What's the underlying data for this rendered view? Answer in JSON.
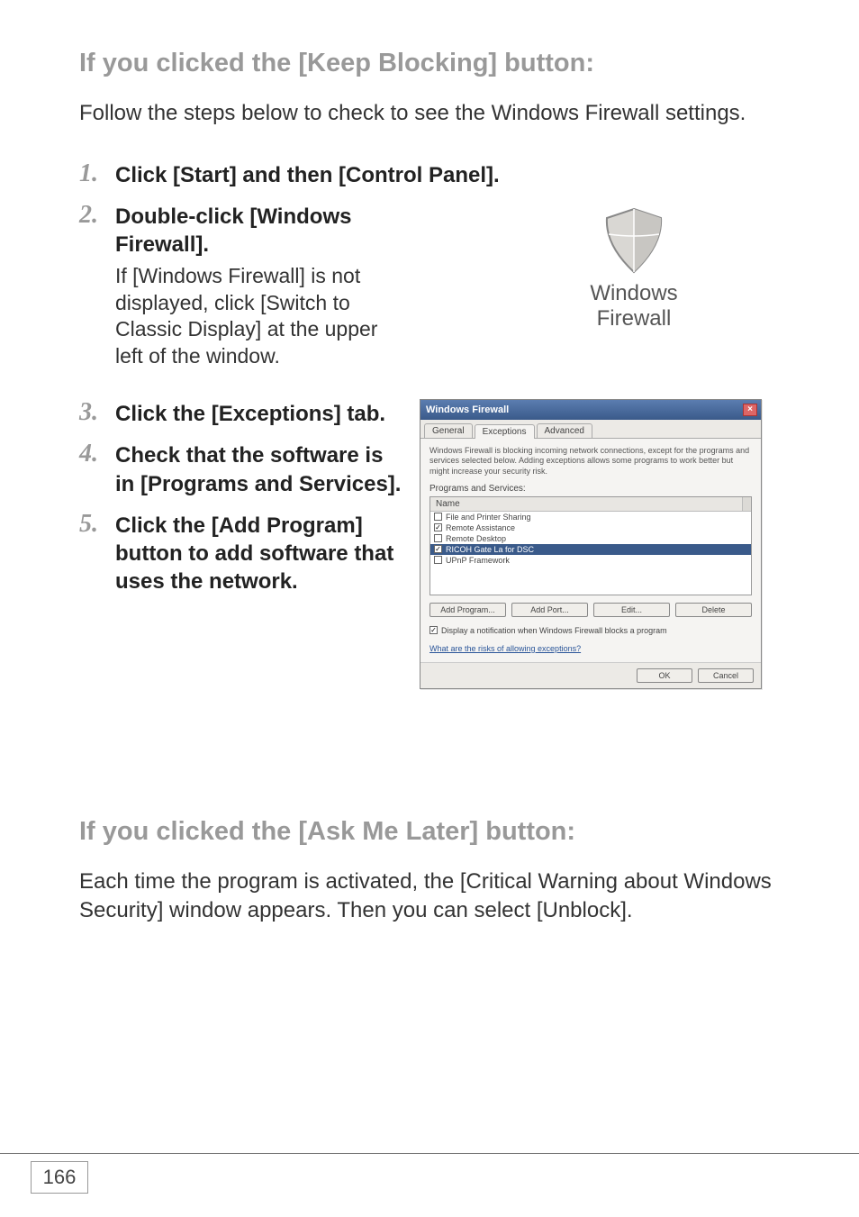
{
  "section1": {
    "heading": "If you clicked the [Keep Blocking] button:",
    "desc": "Follow the steps below to check to see the Windows Firewall settings."
  },
  "steps": {
    "s1": {
      "num": "1.",
      "title": "Click [Start] and then [Control Panel]."
    },
    "s2": {
      "num": "2.",
      "title": "Double-click [Windows Firewall].",
      "note": "If [Windows Firewall] is not displayed, click [Switch to Classic Display] at the upper left of the window."
    },
    "s3": {
      "num": "3.",
      "title": "Click the [Exceptions] tab."
    },
    "s4": {
      "num": "4.",
      "title": "Check that the software is in [Programs and Services]."
    },
    "s5": {
      "num": "5.",
      "title": "Click the [Add Program] button to add software that uses the network."
    }
  },
  "shield": {
    "caption": "Windows\nFirewall"
  },
  "dialog": {
    "title": "Windows Firewall",
    "tabs": {
      "general": "General",
      "exceptions": "Exceptions",
      "advanced": "Advanced"
    },
    "desc": "Windows Firewall is blocking incoming network connections, except for the programs and services selected below. Adding exceptions allows some programs to work better but might increase your security risk.",
    "subhead": "Programs and Services:",
    "list_header": "Name",
    "items": {
      "i0": {
        "label": "File and Printer Sharing",
        "checked": false
      },
      "i1": {
        "label": "Remote Assistance",
        "checked": true
      },
      "i2": {
        "label": "Remote Desktop",
        "checked": false
      },
      "i3": {
        "label": "RICOH Gate La for DSC",
        "checked": true,
        "selected": true
      },
      "i4": {
        "label": "UPnP Framework",
        "checked": false
      }
    },
    "buttons": {
      "add_program": "Add Program...",
      "add_port": "Add Port...",
      "edit": "Edit...",
      "delete": "Delete"
    },
    "notify": "Display a notification when Windows Firewall blocks a program",
    "link": "What are the risks of allowing exceptions?",
    "ok": "OK",
    "cancel": "Cancel"
  },
  "section2": {
    "heading": "If you clicked the [Ask Me Later] button:",
    "desc": "Each time the program is activated, the [Critical Warning about Windows Security] window appears. Then you can select [Unblock]."
  },
  "page_number": "166"
}
